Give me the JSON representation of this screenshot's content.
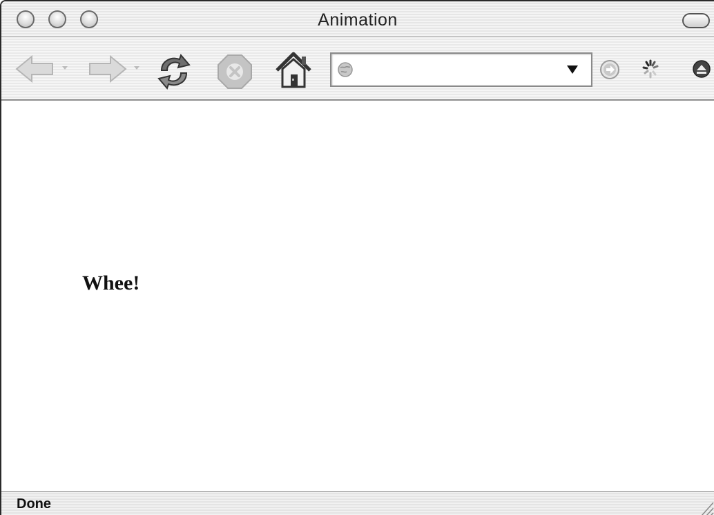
{
  "window": {
    "title": "Animation"
  },
  "toolbar": {
    "back_icon": "back-arrow-icon",
    "forward_icon": "forward-arrow-icon",
    "reload_icon": "reload-icon",
    "stop_icon": "stop-icon",
    "home_icon": "home-icon",
    "address": {
      "value": "",
      "placeholder": "",
      "icon": "globe-icon"
    },
    "go_icon": "go-arrow-icon",
    "throbber_icon": "loading-spinner-icon",
    "sidebar_icon": "eject-icon"
  },
  "content": {
    "text": "Whee!"
  },
  "status": {
    "text": "Done"
  },
  "colors": {
    "chrome_light": "#f4f4f4",
    "chrome_dark": "#e6e6e6",
    "text": "#111111"
  }
}
